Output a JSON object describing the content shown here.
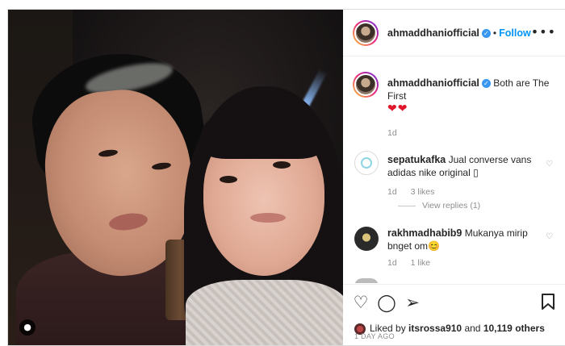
{
  "post": {
    "author": "ahmaddhaniofficial",
    "follow_label": "Follow",
    "more_icon": "more-horizontal-icon"
  },
  "caption": {
    "username": "ahmaddhaniofficial",
    "text": "Both are The First",
    "emoji": "❤❤",
    "age": "1d"
  },
  "comments": [
    {
      "username": "sepatukafka",
      "text": "Jual converse vans adidas nike original ▯",
      "age": "1d",
      "likes": "3 likes",
      "view_replies": "View replies (1)"
    },
    {
      "username": "rakhmadhabib9",
      "text": "Mukanya mirip bnget om",
      "emoji": "😊",
      "age": "1d",
      "likes": "1 like"
    }
  ],
  "actions": {
    "like_icon": "heart-icon",
    "comment_icon": "comment-icon",
    "share_icon": "send-icon",
    "save_icon": "bookmark-icon"
  },
  "likes": {
    "prefix": "Liked by",
    "user": "itsrossa910",
    "and": "and",
    "others": "10,119 others"
  },
  "timestamp": "1 DAY AGO",
  "colors": {
    "link": "#0095f6",
    "verified": "#3897f0",
    "heart": "#e0162b",
    "muted": "#8e8e8e"
  }
}
